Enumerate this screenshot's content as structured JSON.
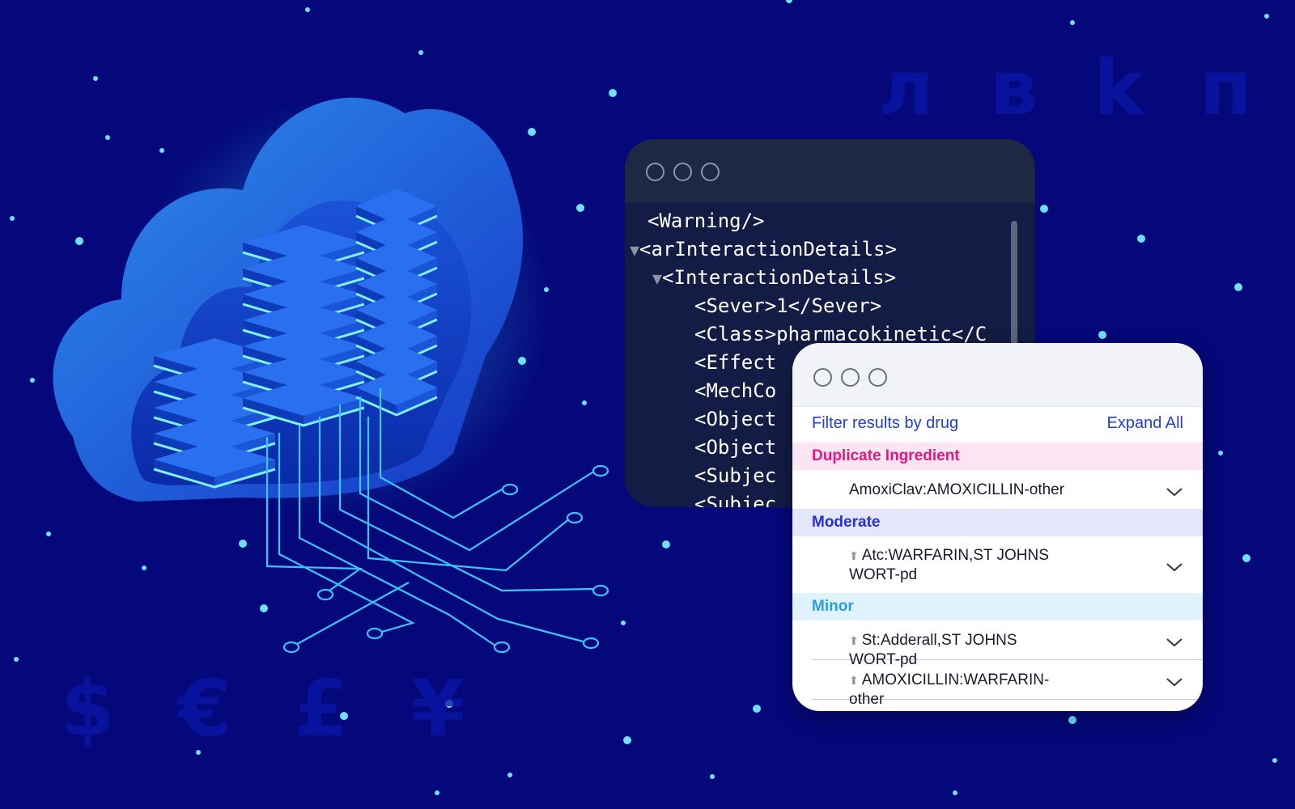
{
  "background": {
    "color": "#04087a",
    "ghost_cyrillic": "л в k п ₽",
    "ghost_currency": "$ € £ ¥"
  },
  "code_window": {
    "lines": [
      {
        "indent": 0,
        "toggle": "",
        "text": "<Warning/>"
      },
      {
        "indent": 0,
        "toggle": "▼",
        "text": "<arInteractionDetails>"
      },
      {
        "indent": 1,
        "toggle": "▼",
        "text": "<InteractionDetails>"
      },
      {
        "indent": 2,
        "toggle": "",
        "text": "<Sever>1</Sever>"
      },
      {
        "indent": 2,
        "toggle": "",
        "text": "<Class>pharmacokinetic</C"
      },
      {
        "indent": 2,
        "toggle": "",
        "text": "<Effect"
      },
      {
        "indent": 2,
        "toggle": "",
        "text": "<MechCo"
      },
      {
        "indent": 2,
        "toggle": "",
        "text": "<Object"
      },
      {
        "indent": 2,
        "toggle": "",
        "text": "<Object"
      },
      {
        "indent": 2,
        "toggle": "",
        "text": "<Subjec"
      },
      {
        "indent": 2,
        "toggle": "",
        "text": "<Subjec"
      }
    ]
  },
  "results_panel": {
    "filter_label": "Filter results by drug",
    "expand_label": "Expand All",
    "groups": [
      {
        "label": "Duplicate Ingredient",
        "color": "#e6177a",
        "bg": "#fde4f2",
        "rows": [
          {
            "text": "AmoxiClav:AMOXICILLIN-other",
            "arrow": false
          }
        ]
      },
      {
        "label": "Moderate",
        "color": "#2a2fd6",
        "bg": "#e4e6fb",
        "rows": [
          {
            "text": "Atc:WARFARIN,ST JOHNS WORT-pd",
            "arrow": true
          }
        ]
      },
      {
        "label": "Minor",
        "color": "#2b9ee3",
        "bg": "#e0f3fc",
        "rows": [
          {
            "text": "St:Adderall,ST JOHNS WORT-pd",
            "arrow": true
          },
          {
            "text": "AMOXICILLIN:WARFARIN-other",
            "arrow": true
          }
        ]
      }
    ]
  },
  "icons": {
    "window_controls": "circle-outline",
    "row_toggle": "chevron-down-icon",
    "row_marker": "arrow-up-icon"
  }
}
